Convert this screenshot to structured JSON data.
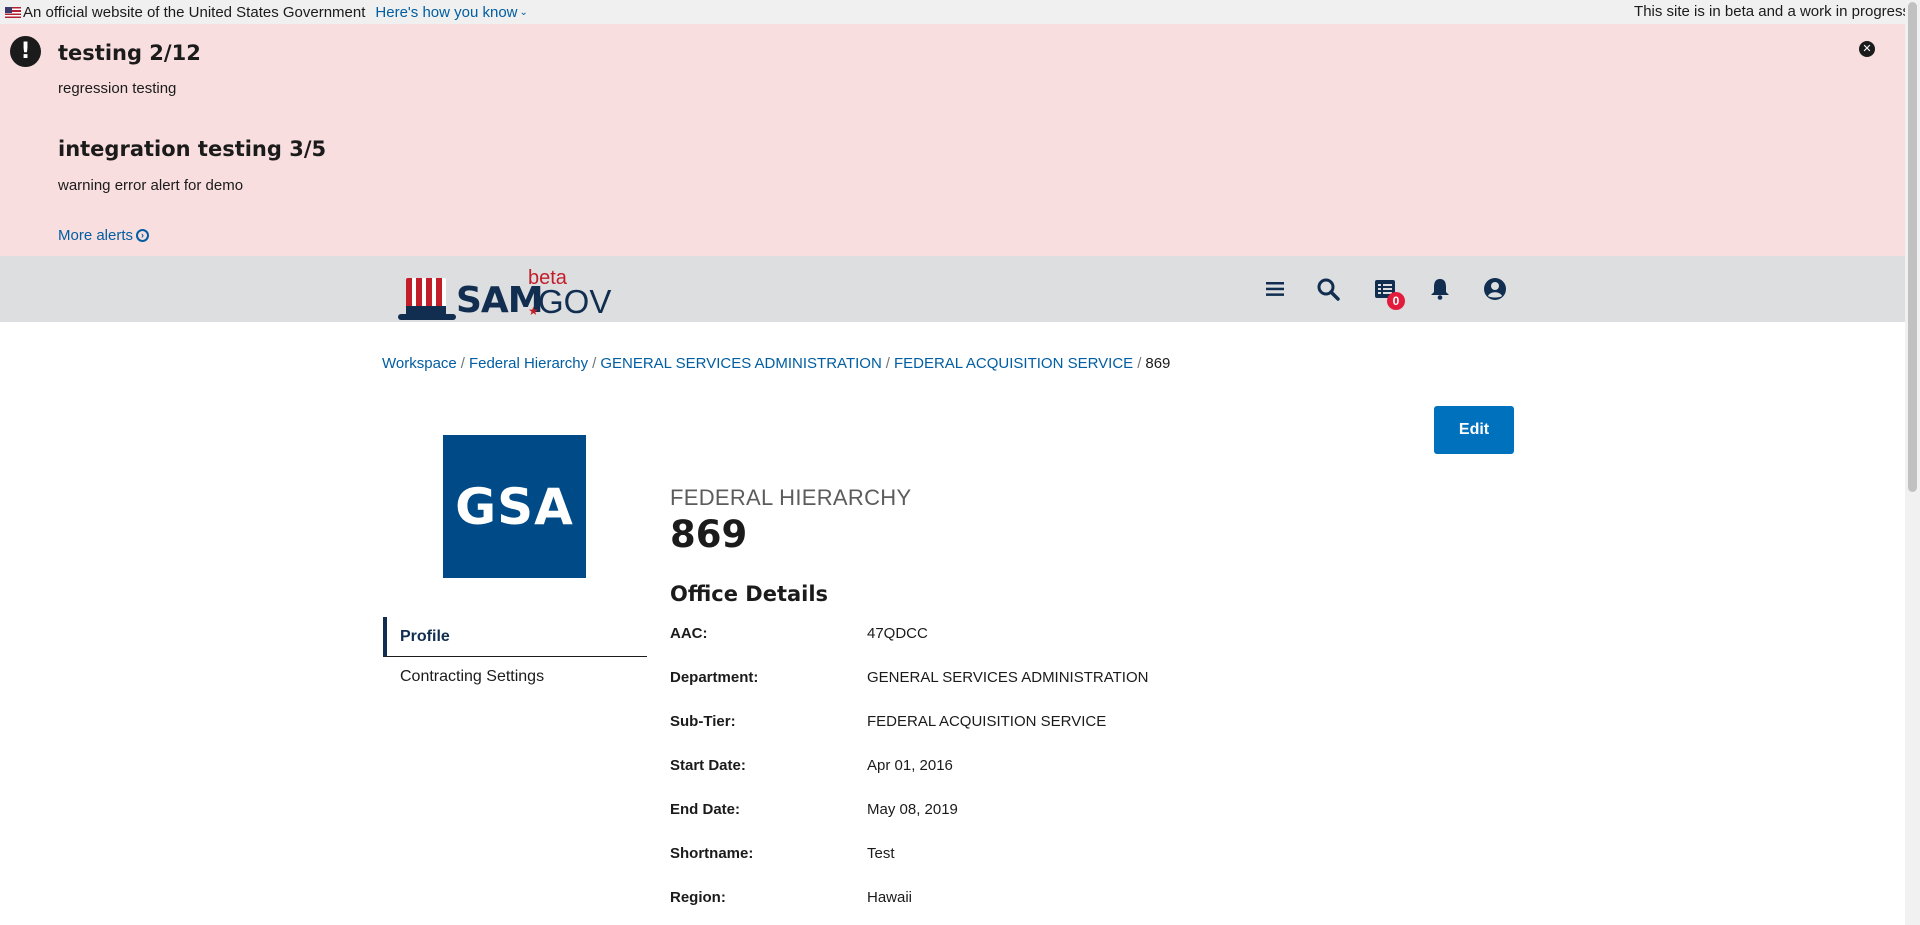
{
  "gov_banner": {
    "official_text": "An official website of the United States Government",
    "how_link": "Here's how you know",
    "beta_note": "This site is in beta and a work in progress"
  },
  "alerts": {
    "items": [
      {
        "title": "testing 2/12",
        "body": "regression testing"
      },
      {
        "title": "integration testing 3/5",
        "body": "warning error alert for demo"
      }
    ],
    "more_link": "More alerts"
  },
  "header": {
    "logo": {
      "sam": "SAM",
      "beta": "beta",
      "gov": "GOV"
    },
    "icons": [
      "menu-icon",
      "search-icon",
      "messages-icon",
      "notifications-icon",
      "account-icon"
    ],
    "messages_count": "0"
  },
  "breadcrumb": {
    "items": [
      "Workspace",
      "Federal Hierarchy",
      "GENERAL SERVICES ADMINISTRATION",
      "FEDERAL ACQUISITION SERVICE"
    ],
    "current": "869"
  },
  "edit_label": "Edit",
  "gsa_logo_text": "GSA",
  "sidenav": {
    "items": [
      "Profile",
      "Contracting Settings"
    ]
  },
  "page": {
    "kicker": "FEDERAL HIERARCHY",
    "title": "869",
    "section_title": "Office Details"
  },
  "details": [
    {
      "label": "AAC:",
      "value": "47QDCC"
    },
    {
      "label": "Department:",
      "value": "GENERAL SERVICES ADMINISTRATION"
    },
    {
      "label": "Sub-Tier:",
      "value": "FEDERAL ACQUISITION SERVICE"
    },
    {
      "label": "Start Date:",
      "value": "Apr 01, 2016"
    },
    {
      "label": "End Date:",
      "value": "May 08, 2019"
    },
    {
      "label": "Shortname:",
      "value": "Test"
    },
    {
      "label": "Region:",
      "value": "Hawaii"
    }
  ],
  "colors": {
    "alert_bg": "#f9dedf",
    "header_bg": "#dcdee0",
    "link": "#005ea2",
    "primary_button": "#0071bc",
    "gsa_blue": "#004b87",
    "navy": "#112e51",
    "badge_red": "#e31c3d"
  }
}
